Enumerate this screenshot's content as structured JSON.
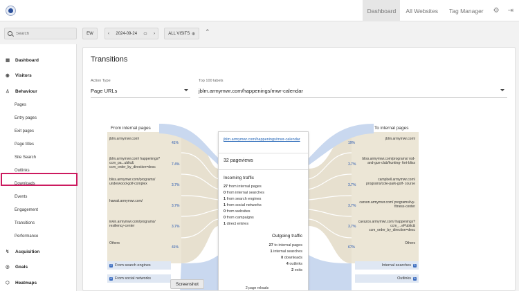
{
  "topbar": {
    "items": [
      "Dashboard",
      "All Websites",
      "Tag Manager"
    ],
    "gear_icon": "⚙",
    "logout_icon": "⇥"
  },
  "controls": {
    "search_placeholder": "Search",
    "period": "EW",
    "date": "2024-09-24",
    "segment": "ALL VISITS"
  },
  "sidebar": {
    "sections": [
      {
        "icon": "▦",
        "label": "Dashboard"
      },
      {
        "icon": "◉",
        "label": "Visitors"
      },
      {
        "icon": "♙",
        "label": "Behaviour"
      },
      {
        "icon": "↯",
        "label": "Acquisition"
      },
      {
        "icon": "◎",
        "label": "Goals"
      },
      {
        "icon": "⬡",
        "label": "Heatmaps"
      }
    ],
    "behaviour_items": [
      "Pages",
      "Entry pages",
      "Exit pages",
      "Page titles",
      "Site Search",
      "Outlinks",
      "Downloads",
      "Events",
      "Engagement",
      "Transitions",
      "Performance"
    ]
  },
  "main": {
    "title": "Transitions",
    "action_type_label": "Action Type",
    "action_type_value": "Page URLs",
    "top_label": "Top 100 labels",
    "top_value": "jblm.armymwr.com/happenings/mwr-calendar",
    "from_internal": "From internal pages",
    "to_internal": "To internal pages",
    "left_nodes": [
      {
        "label": "jblm.armymwr.com/",
        "pct": "41%"
      },
      {
        "label": "jblm.armymwr.com/ happenings?ccm_pa...ublic& ccm_order_by_direction=desc",
        "pct": "7.4%"
      },
      {
        "label": "bliss.armymwr.com/programs/ underwood-golf-complex",
        "pct": "3.7%"
      },
      {
        "label": "hawaii.armymwr.com/",
        "pct": "3.7%"
      },
      {
        "label": "irwin.armymwr.com/programs/ resiliency-center",
        "pct": "3.7%"
      },
      {
        "label": "Others",
        "pct": "41%"
      }
    ],
    "right_nodes": [
      {
        "label": "jblm.armymwr.com/",
        "pct": "19%"
      },
      {
        "label": "bliss.armymwr.com/programs/ rod-and-gun-club/hunting- fort-bliss",
        "pct": "3.7%"
      },
      {
        "label": "campbell.armymwr.com/ programs/cole-park-golf- course",
        "pct": "3.7%"
      },
      {
        "label": "carson.armymwr.com/ programs/ivy-fitness-center",
        "pct": "3.7%"
      },
      {
        "label": "cavazos.armymwr.com/ happenings?ccm_...ePublic& ccm_order_by_direction=desc",
        "pct": "3.7%"
      },
      {
        "label": "Others",
        "pct": "67%"
      }
    ],
    "from_search": "From search engines",
    "from_social": "From social networks",
    "internal_searches": "Internal searches",
    "outlinks": "Outlinks",
    "center": {
      "link": "jblm.armymwr.com/happenings/mwr-calendar",
      "pageviews": "32 pageviews",
      "incoming_title": "Incoming traffic",
      "incoming": [
        {
          "n": "27",
          "t": "from internal pages"
        },
        {
          "n": "0",
          "t": "from internal searches"
        },
        {
          "n": "1",
          "t": "from search engines"
        },
        {
          "n": "1",
          "t": "from social networks"
        },
        {
          "n": "0",
          "t": "from websites"
        },
        {
          "n": "0",
          "t": "from campaigns"
        },
        {
          "n": "1",
          "t": "direct entries"
        }
      ],
      "outgoing_title": "Outgoing traffic",
      "outgoing": [
        {
          "n": "27",
          "t": "to internal pages"
        },
        {
          "n": "1",
          "t": "internal searches"
        },
        {
          "n": "0",
          "t": "downloads"
        },
        {
          "n": "4",
          "t": "outlinks"
        },
        {
          "n": "2",
          "t": "exits"
        }
      ],
      "reloads": "2 page reloads"
    },
    "screenshot_button": "Screenshot"
  },
  "colors": {
    "accent": "#cc1a5f",
    "flow_beige": "#e7e0cf",
    "flow_blue": "#c9d8ef",
    "link": "#1a5fb4"
  }
}
